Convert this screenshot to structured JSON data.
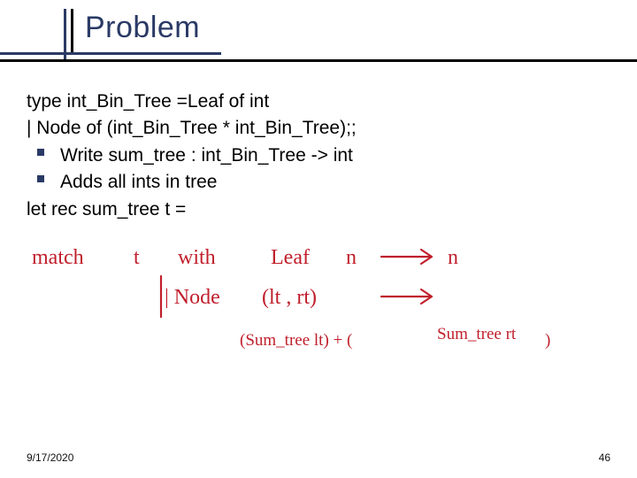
{
  "title": "Problem",
  "lines": {
    "l1": "type int_Bin_Tree =Leaf of int",
    "l2": "| Node of (int_Bin_Tree * int_Bin_Tree);;",
    "b1": "Write sum_tree : int_Bin_Tree -> int",
    "b2": "Adds all ints in tree",
    "l3": "let rec sum_tree t ="
  },
  "handwriting": {
    "r1a": "match",
    "r1b": "t",
    "r1c": "with",
    "r1d": "Leaf",
    "r1e": "n",
    "r1f": "n",
    "r2a": "| Node",
    "r2b": "(lt , rt)",
    "r3a": "(Sum_tree lt) + (",
    "r3b": "Sum_tree rt",
    "r3c": ")"
  },
  "footer": {
    "date": "9/17/2020",
    "page": "46"
  }
}
